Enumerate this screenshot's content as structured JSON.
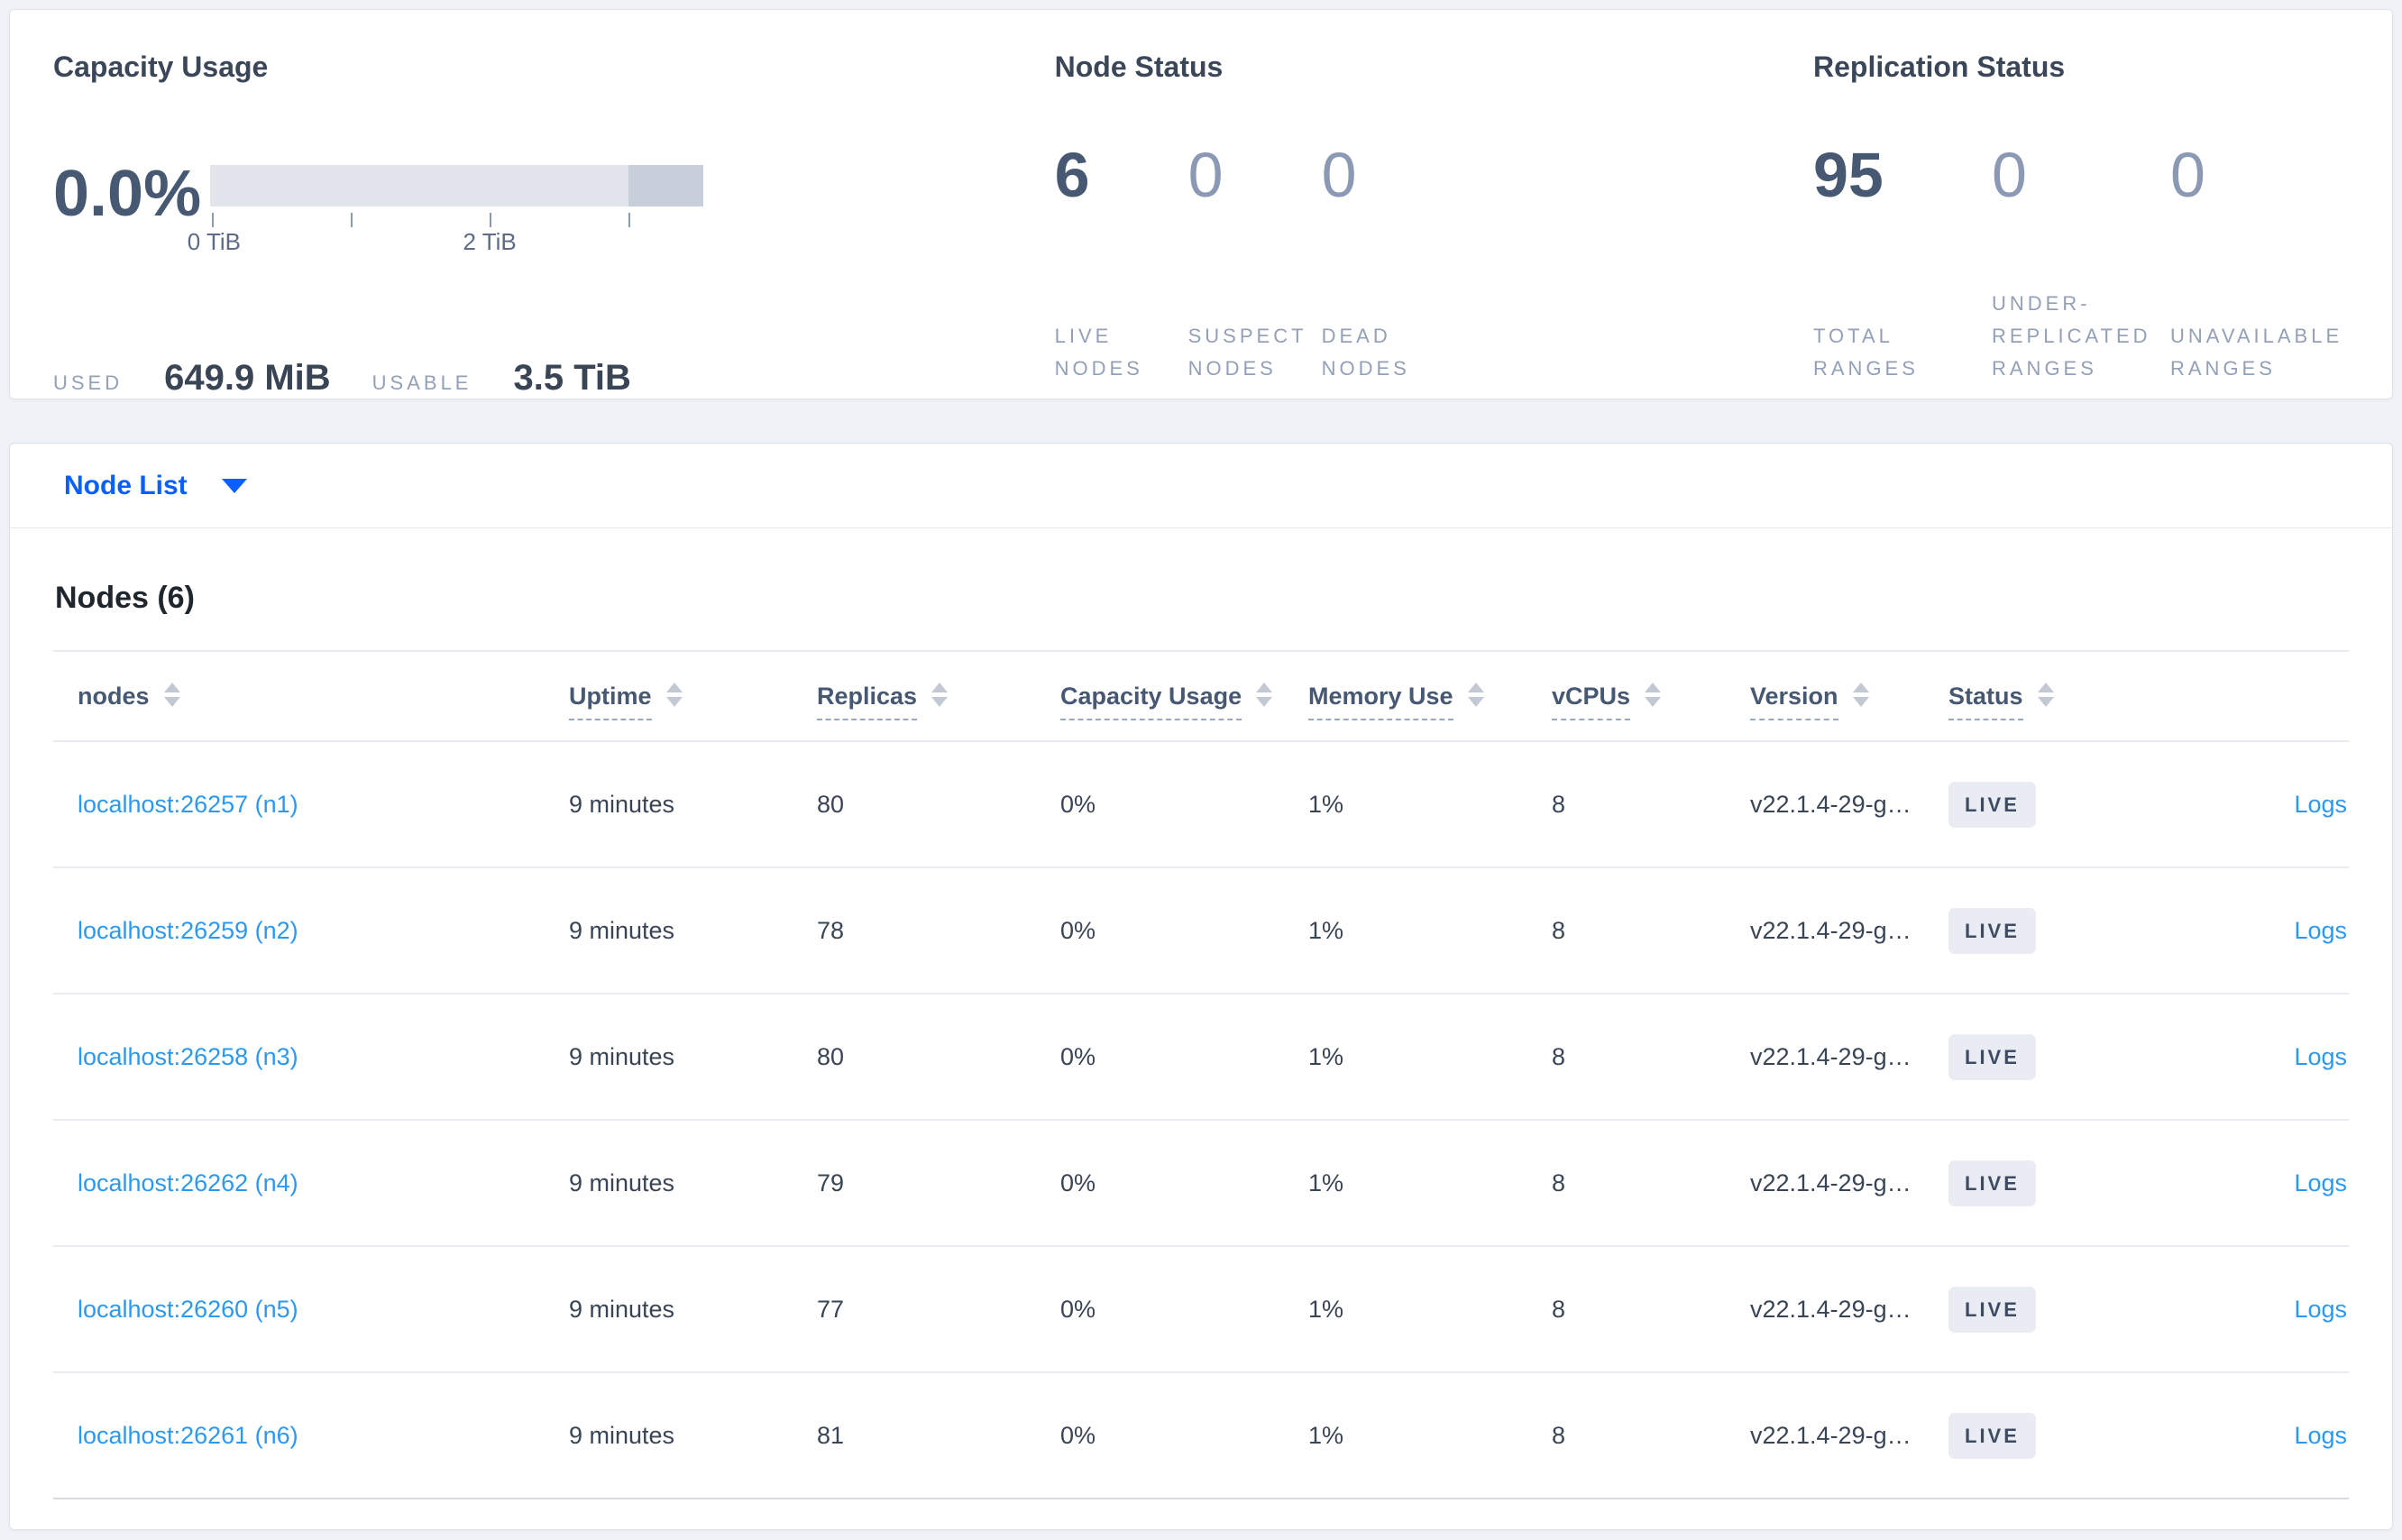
{
  "colors": {
    "accent_blue": "#0b5fff",
    "link_blue": "#2b99f3",
    "badge_bg": "#e9edf3",
    "badge_text": "#3e4c63",
    "bar_track": "#e2e5ec",
    "bar_reserved": "#c9cfda"
  },
  "summary": {
    "capacity": {
      "title": "Capacity Usage",
      "percent": "0.0%",
      "tick_labels": [
        "0 TiB",
        "2 TiB"
      ],
      "used_label": "USED",
      "used_value": "649.9 MiB",
      "usable_label": "USABLE",
      "usable_value": "3.5 TiB"
    },
    "node_status": {
      "title": "Node Status",
      "stats": [
        {
          "value": "6",
          "label": "LIVE NODES"
        },
        {
          "value": "0",
          "label": "SUSPECT NODES"
        },
        {
          "value": "0",
          "label": "DEAD NODES"
        }
      ]
    },
    "replication_status": {
      "title": "Replication Status",
      "stats": [
        {
          "value": "95",
          "label": "TOTAL RANGES"
        },
        {
          "value": "0",
          "label": "UNDER-REPLICATED RANGES"
        },
        {
          "value": "0",
          "label": "UNAVAILABLE RANGES"
        }
      ]
    }
  },
  "nav": {
    "dropdown_label": "Node List"
  },
  "nodes_section": {
    "title": "Nodes (6)",
    "columns": [
      {
        "key": "node",
        "label": "nodes",
        "sortable": true,
        "dashed": false
      },
      {
        "key": "uptime",
        "label": "Uptime",
        "sortable": true,
        "dashed": true
      },
      {
        "key": "replicas",
        "label": "Replicas",
        "sortable": true,
        "dashed": true
      },
      {
        "key": "capacity_usage",
        "label": "Capacity Usage",
        "sortable": true,
        "dashed": true
      },
      {
        "key": "memory_use",
        "label": "Memory Use",
        "sortable": true,
        "dashed": true
      },
      {
        "key": "vcpus",
        "label": "vCPUs",
        "sortable": true,
        "dashed": true
      },
      {
        "key": "version",
        "label": "Version",
        "sortable": true,
        "dashed": true
      },
      {
        "key": "status",
        "label": "Status",
        "sortable": true,
        "dashed": true
      },
      {
        "key": "logs",
        "label": "",
        "sortable": false,
        "dashed": false
      }
    ],
    "rows": [
      {
        "node": "localhost:26257 (n1)",
        "uptime": "9 minutes",
        "replicas": "80",
        "capacity_usage": "0%",
        "memory_use": "1%",
        "vcpus": "8",
        "version": "v22.1.4-29-g…",
        "status": "LIVE",
        "logs": "Logs"
      },
      {
        "node": "localhost:26259 (n2)",
        "uptime": "9 minutes",
        "replicas": "78",
        "capacity_usage": "0%",
        "memory_use": "1%",
        "vcpus": "8",
        "version": "v22.1.4-29-g…",
        "status": "LIVE",
        "logs": "Logs"
      },
      {
        "node": "localhost:26258 (n3)",
        "uptime": "9 minutes",
        "replicas": "80",
        "capacity_usage": "0%",
        "memory_use": "1%",
        "vcpus": "8",
        "version": "v22.1.4-29-g…",
        "status": "LIVE",
        "logs": "Logs"
      },
      {
        "node": "localhost:26262 (n4)",
        "uptime": "9 minutes",
        "replicas": "79",
        "capacity_usage": "0%",
        "memory_use": "1%",
        "vcpus": "8",
        "version": "v22.1.4-29-g…",
        "status": "LIVE",
        "logs": "Logs"
      },
      {
        "node": "localhost:26260 (n5)",
        "uptime": "9 minutes",
        "replicas": "77",
        "capacity_usage": "0%",
        "memory_use": "1%",
        "vcpus": "8",
        "version": "v22.1.4-29-g…",
        "status": "LIVE",
        "logs": "Logs"
      },
      {
        "node": "localhost:26261 (n6)",
        "uptime": "9 minutes",
        "replicas": "81",
        "capacity_usage": "0%",
        "memory_use": "1%",
        "vcpus": "8",
        "version": "v22.1.4-29-g…",
        "status": "LIVE",
        "logs": "Logs"
      }
    ]
  }
}
